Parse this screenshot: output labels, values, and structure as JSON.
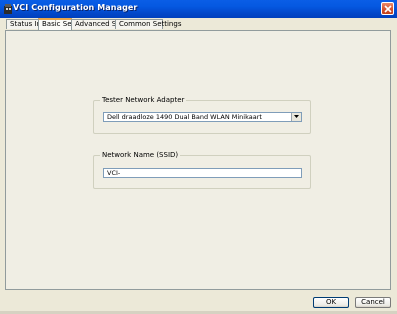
{
  "window": {
    "title": "VCI Configuration Manager",
    "close_icon": "close-icon"
  },
  "tabs": [
    {
      "label": "Status Info"
    },
    {
      "label": "Basic Setup",
      "active": true
    },
    {
      "label": "Advanced Setup"
    },
    {
      "label": "Common Settings"
    }
  ],
  "basic_setup": {
    "adapter_group_label": "Tester Network Adapter",
    "adapter_selected": "Dell draadloze 1490 Dual Band WLAN Minikaart",
    "ssid_group_label": "Network Name (SSID)",
    "ssid_value": "VCI-"
  },
  "footer": {
    "ok_label": "OK",
    "cancel_label": "Cancel"
  },
  "colors": {
    "titlebar": "#0558e1",
    "background": "#ece9d8",
    "active_tab_accent": "#e8a54b"
  }
}
